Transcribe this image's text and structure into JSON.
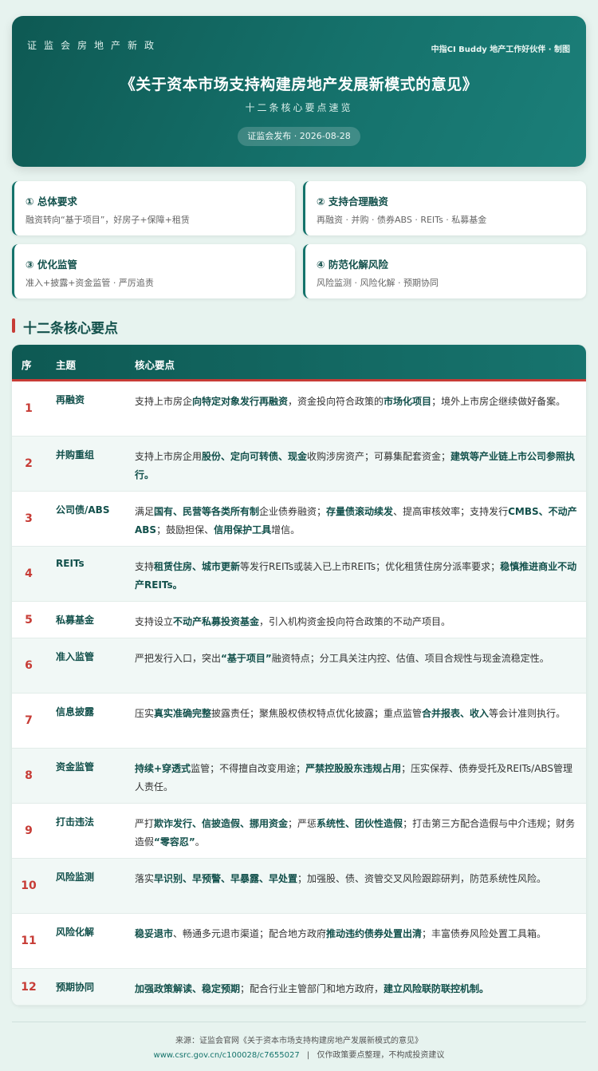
{
  "header": {
    "tag": "证监会房地产新政",
    "credit": "中指CI Buddy 地产工作好伙伴 · 制图",
    "title": "《关于资本市场支持构建房地产发展新模式的意见》",
    "subtitle": "十二条核心要点速览",
    "published": "证监会发布 · 2026-08-28"
  },
  "pillars": [
    {
      "title": "① 总体要求",
      "desc": "融资转向“基于项目”，好房子+保障+租赁"
    },
    {
      "title": "② 支持合理融资",
      "desc": "再融资 · 并购 · 债券ABS · REITs · 私募基金"
    },
    {
      "title": "③ 优化监管",
      "desc": "准入+披露+资金监管 · 严厉追责"
    },
    {
      "title": "④ 防范化解风险",
      "desc": "风险监测 · 风险化解 · 预期协同"
    }
  ],
  "section_title": "十二条核心要点",
  "table": {
    "headers": [
      "序",
      "主题",
      "核心要点"
    ],
    "rows": [
      {
        "no": "1",
        "topic": "再融资",
        "segments": [
          {
            "t": "支持上市房企"
          },
          {
            "t": "向特定对象发行再融资",
            "b": true
          },
          {
            "t": "，资金投向符合政策的"
          },
          {
            "t": "市场化项目",
            "b": true
          },
          {
            "t": "；境外上市房企继续做好备案。"
          }
        ]
      },
      {
        "no": "2",
        "topic": "并购重组",
        "segments": [
          {
            "t": "支持上市房企用"
          },
          {
            "t": "股份、定向可转债、现金",
            "b": true
          },
          {
            "t": "收购涉房资产；可募集配套资金；"
          },
          {
            "t": "建筑等产业链上市公司参照执行。",
            "b": true
          }
        ]
      },
      {
        "no": "3",
        "topic": "公司债/ABS",
        "segments": [
          {
            "t": "满足"
          },
          {
            "t": "国有、民营等各类所有制",
            "b": true
          },
          {
            "t": "企业债券融资；"
          },
          {
            "t": "存量债滚动续发",
            "b": true
          },
          {
            "t": "、提高审核效率；支持发行"
          },
          {
            "t": "CMBS、不动产ABS",
            "b": true
          },
          {
            "t": "；鼓励担保、"
          },
          {
            "t": "信用保护工具",
            "b": true
          },
          {
            "t": "增信。"
          }
        ]
      },
      {
        "no": "4",
        "topic": "REITs",
        "segments": [
          {
            "t": "支持"
          },
          {
            "t": "租赁住房、城市更新",
            "b": true
          },
          {
            "t": "等发行REITs或装入已上市REITs；优化租赁住房分派率要求；"
          },
          {
            "t": "稳慎推进商业不动产REITs。",
            "b": true
          }
        ]
      },
      {
        "no": "5",
        "topic": "私募基金",
        "segments": [
          {
            "t": "支持设立"
          },
          {
            "t": "不动产私募投资基金",
            "b": true
          },
          {
            "t": "，引入机构资金投向符合政策的不动产项目。"
          }
        ]
      },
      {
        "no": "6",
        "topic": "准入监管",
        "segments": [
          {
            "t": "严把发行入口，突出"
          },
          {
            "t": "“基于项目”",
            "b": true
          },
          {
            "t": "融资特点；分工具关注内控、估值、项目合规性与现金流稳定性。"
          }
        ]
      },
      {
        "no": "7",
        "topic": "信息披露",
        "segments": [
          {
            "t": "压实"
          },
          {
            "t": "真实准确完整",
            "b": true
          },
          {
            "t": "披露责任；聚焦股权债权特点优化披露；重点监管"
          },
          {
            "t": "合并报表、收入",
            "b": true
          },
          {
            "t": "等会计准则执行。"
          }
        ]
      },
      {
        "no": "8",
        "topic": "资金监管",
        "segments": [
          {
            "t": "持续+穿透式",
            "b": true
          },
          {
            "t": "监管；不得擅自改变用途；"
          },
          {
            "t": "严禁控股股东违规占用",
            "b": true
          },
          {
            "t": "；压实保荐、债券受托及REITs/ABS管理人责任。"
          }
        ]
      },
      {
        "no": "9",
        "topic": "打击违法",
        "segments": [
          {
            "t": "严打"
          },
          {
            "t": "欺诈发行、信披造假、挪用资金",
            "b": true
          },
          {
            "t": "；严惩"
          },
          {
            "t": "系统性、团伙性造假",
            "b": true
          },
          {
            "t": "；打击第三方配合造假与中介违规；财务造假"
          },
          {
            "t": "“零容忍”",
            "b": true
          },
          {
            "t": "。"
          }
        ]
      },
      {
        "no": "10",
        "topic": "风险监测",
        "segments": [
          {
            "t": "落实"
          },
          {
            "t": "早识别、早预警、早暴露、早处置",
            "b": true
          },
          {
            "t": "；加强股、债、资管交叉风险跟踪研判，防范系统性风险。"
          }
        ]
      },
      {
        "no": "11",
        "topic": "风险化解",
        "segments": [
          {
            "t": "稳妥退市",
            "b": true
          },
          {
            "t": "、畅通多元退市渠道；配合地方政府"
          },
          {
            "t": "推动违约债券处置出清",
            "b": true
          },
          {
            "t": "；丰富债券风险处置工具箱。"
          }
        ]
      },
      {
        "no": "12",
        "topic": "预期协同",
        "segments": [
          {
            "t": "加强政策解读、稳定预期",
            "b": true
          },
          {
            "t": "；配合行业主管部门和地方政府，"
          },
          {
            "t": "建立风险联防联控机制。",
            "b": true
          }
        ]
      }
    ]
  },
  "footer": {
    "source": "来源：证监会官网《关于资本市场支持构建房地产发展新模式的意见》",
    "url": "www.csrc.gov.cn/c100028/c7655027",
    "separator": "|",
    "disclaimer": "仅作政策要点整理，不构成投资建议"
  },
  "colors": {
    "brand_teal": "#0e5953",
    "accent_red": "#c73c36",
    "row_alt": "#f1f8f6",
    "page_bg": "#e7f3ef"
  }
}
